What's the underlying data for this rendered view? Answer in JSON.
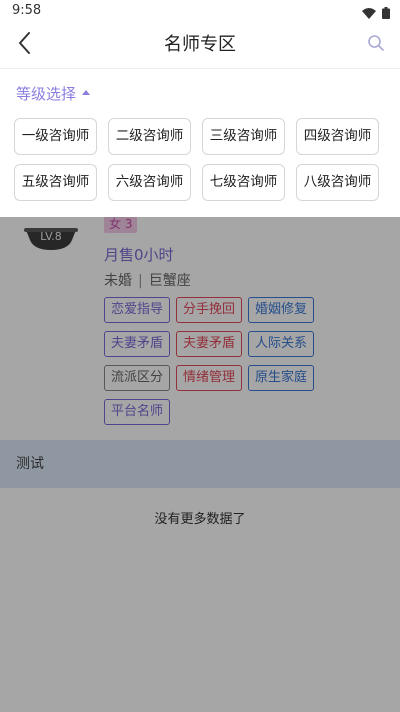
{
  "status_bar": {
    "time": "9:58"
  },
  "nav": {
    "title": "名师专区"
  },
  "filter": {
    "title": "等级选择",
    "levels": [
      "一级咨询师",
      "二级咨询师",
      "三级咨询师",
      "四级咨询师",
      "五级咨询师",
      "六级咨询师",
      "七级咨询师",
      "八级咨询师"
    ]
  },
  "card": {
    "level_badge": "LV.8",
    "count_tag": "女 3",
    "sales": "月售0小时",
    "marital_status": "未婚",
    "separator": "|",
    "zodiac": "巨蟹座",
    "tags": [
      {
        "label": "恋爱指导",
        "color": "purple"
      },
      {
        "label": "分手挽回",
        "color": "red"
      },
      {
        "label": "婚姻修复",
        "color": "blue"
      },
      {
        "label": "夫妻矛盾",
        "color": "purple"
      },
      {
        "label": "夫妻矛盾",
        "color": "red"
      },
      {
        "label": "人际关系",
        "color": "blue"
      },
      {
        "label": "流派区分",
        "color": "gray"
      },
      {
        "label": "情绪管理",
        "color": "red"
      },
      {
        "label": "原生家庭",
        "color": "blue"
      },
      {
        "label": "平台名师",
        "color": "purple"
      }
    ]
  },
  "section": {
    "title": "测试"
  },
  "footer": {
    "no_more": "没有更多数据了"
  },
  "colors": {
    "accent": "#8a7fe0",
    "overlay": "#00000059"
  }
}
